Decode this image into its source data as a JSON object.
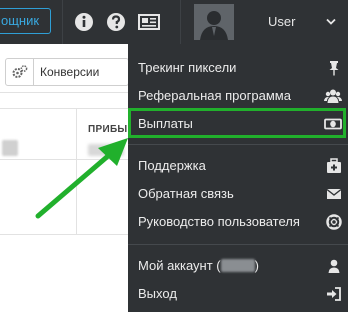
{
  "navbar": {
    "partner_button_label": "ощник",
    "user_label": "User"
  },
  "toolbar": {
    "select_value": "Конверсии"
  },
  "table": {
    "header_label": "ПРИБЫ"
  },
  "user_menu": {
    "items": [
      {
        "label": "Трекинг пиксели",
        "icon": "pin-icon"
      },
      {
        "label": "Реферальная программа",
        "icon": "users-icon"
      },
      {
        "label": "Выплаты",
        "icon": "money-icon"
      },
      {
        "label": "Поддержка",
        "icon": "medkit-icon"
      },
      {
        "label": "Обратная связь",
        "icon": "envelope-icon"
      },
      {
        "label": "Руководство пользователя",
        "icon": "lifebuoy-icon"
      },
      {
        "label_prefix": "Мой аккаунт (",
        "label_suffix": ")",
        "icon": "user-icon"
      },
      {
        "label": "Выход",
        "icon": "sign-out-icon"
      }
    ]
  },
  "colors": {
    "navbar_bg": "#2f3235",
    "highlight": "#21b02c",
    "accent": "#39a9e0"
  }
}
